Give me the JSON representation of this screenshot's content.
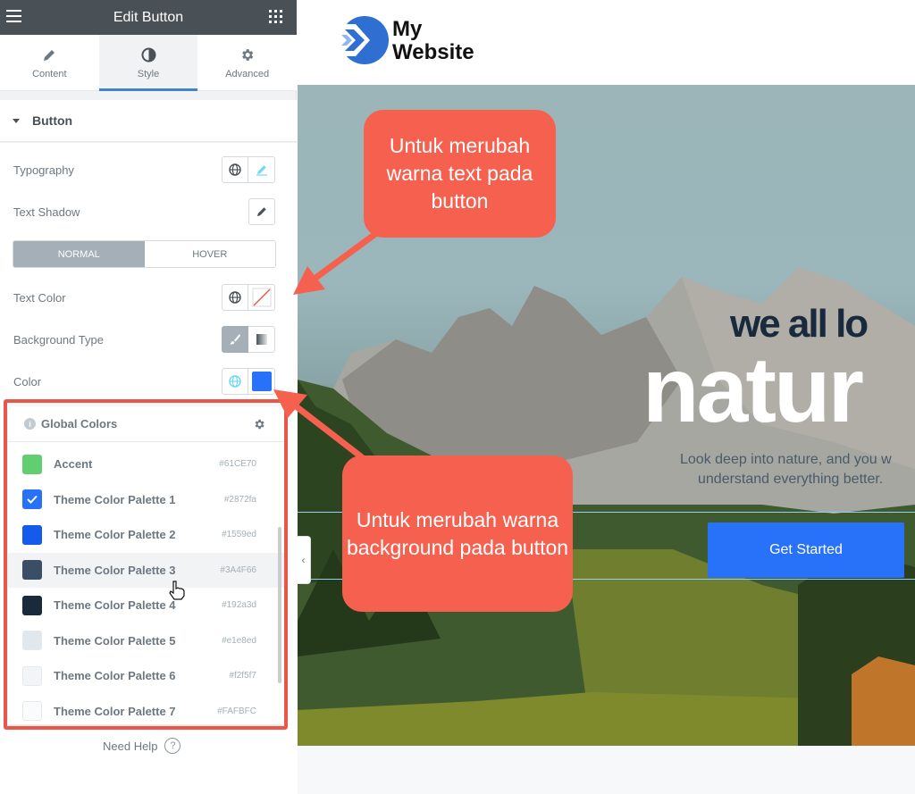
{
  "editor": {
    "title": "Edit Button",
    "tabs": [
      {
        "label": "Content",
        "icon": "pencil-icon"
      },
      {
        "label": "Style",
        "icon": "contrast-icon"
      },
      {
        "label": "Advanced",
        "icon": "gear-icon"
      }
    ],
    "section": "Button",
    "controls": {
      "typography": "Typography",
      "text_shadow": "Text Shadow",
      "normal": "NORMAL",
      "hover": "HOVER",
      "text_color": "Text Color",
      "background_type": "Background Type",
      "color": "Color"
    },
    "color_value": "#2872fa",
    "need_help": "Need Help",
    "need_help_icon": "?"
  },
  "global_colors": {
    "title": "Global Colors",
    "info_icon": "i",
    "items": [
      {
        "name": "Accent",
        "hex": "#61CE70",
        "color": "#61CE70"
      },
      {
        "name": "Theme Color Palette 1",
        "hex": "#2872fa",
        "color": "#2872fa",
        "selected": true
      },
      {
        "name": "Theme Color Palette 2",
        "hex": "#1559ed",
        "color": "#1559ed"
      },
      {
        "name": "Theme Color Palette 3",
        "hex": "#3A4F66",
        "color": "#3A4F66",
        "hovered": true
      },
      {
        "name": "Theme Color Palette 4",
        "hex": "#192a3d",
        "color": "#192a3d"
      },
      {
        "name": "Theme Color Palette 5",
        "hex": "#e1e8ed",
        "color": "#e1e8ed"
      },
      {
        "name": "Theme Color Palette 6",
        "hex": "#f2f5f7",
        "color": "#f2f5f7"
      },
      {
        "name": "Theme Color Palette 7",
        "hex": "#FAFBFC",
        "color": "#FAFBFC"
      }
    ]
  },
  "preview": {
    "brand_line1": "My",
    "brand_line2": "Website",
    "hero_small": "we all lo",
    "hero_big": "natur",
    "hero_sub1": "Look deep into nature, and you w",
    "hero_sub2": "understand everything better.",
    "cta": "Get Started"
  },
  "callouts": {
    "text_color": "Untuk merubah warna text pada button",
    "background": "Untuk merubah warna background pada button"
  },
  "colors": {
    "accent": "#f6614f",
    "primary": "#2872fa",
    "topbar": "#495157"
  }
}
